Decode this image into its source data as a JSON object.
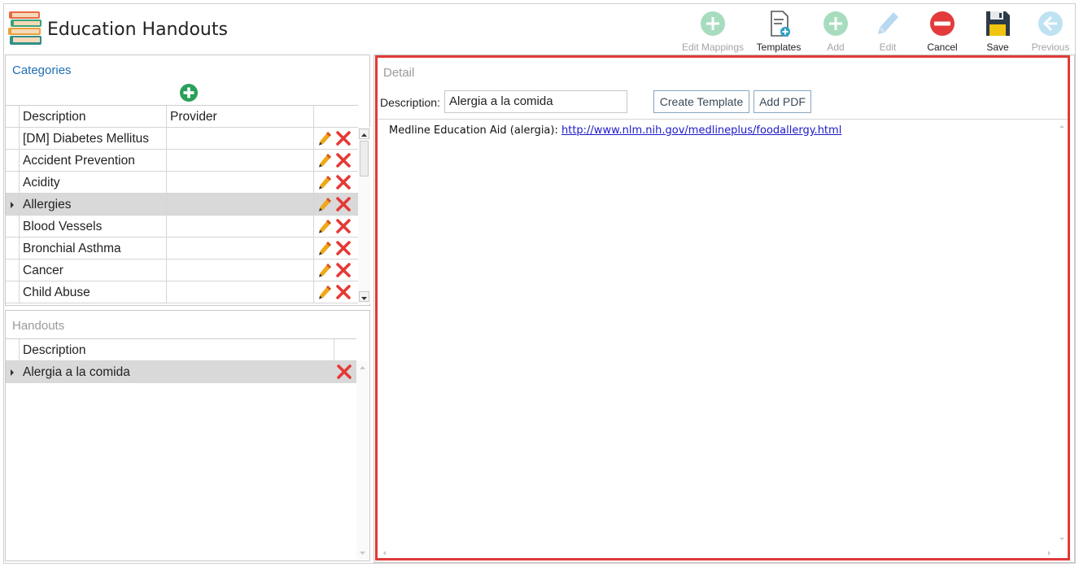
{
  "app": {
    "title": "Education Handouts"
  },
  "toolbar": {
    "edit_mappings": "Edit Mappings",
    "templates": "Templates",
    "add": "Add",
    "edit": "Edit",
    "cancel": "Cancel",
    "save": "Save",
    "previous": "Previous"
  },
  "categories": {
    "title": "Categories",
    "columns": [
      "Description",
      "Provider"
    ],
    "rows": [
      {
        "description": "[DM] Diabetes Mellitus",
        "provider": ""
      },
      {
        "description": "Accident Prevention",
        "provider": ""
      },
      {
        "description": "Acidity",
        "provider": ""
      },
      {
        "description": "Allergies",
        "provider": "",
        "selected": true
      },
      {
        "description": "Blood Vessels",
        "provider": ""
      },
      {
        "description": "Bronchial Asthma",
        "provider": ""
      },
      {
        "description": "Cancer",
        "provider": ""
      },
      {
        "description": "Child Abuse",
        "provider": ""
      }
    ]
  },
  "handouts": {
    "title": "Handouts",
    "columns": [
      "Description"
    ],
    "rows": [
      {
        "description": "Alergia a la comida",
        "selected": true
      }
    ]
  },
  "detail": {
    "title": "Detail",
    "description_label": "Description:",
    "description_value": "Alergia a la comida",
    "create_template": "Create Template",
    "add_pdf": "Add PDF",
    "content_prefix": "Medline Education Aid (alergia): ",
    "content_link": "http://www.nlm.nih.gov/medlineplus/foodallergy.html"
  },
  "colors": {
    "accent_blue": "#1f6eb5",
    "muted_title": "#9a9a9a",
    "highlight_border": "#e03a3a",
    "selected_row": "#d9d9d9"
  }
}
